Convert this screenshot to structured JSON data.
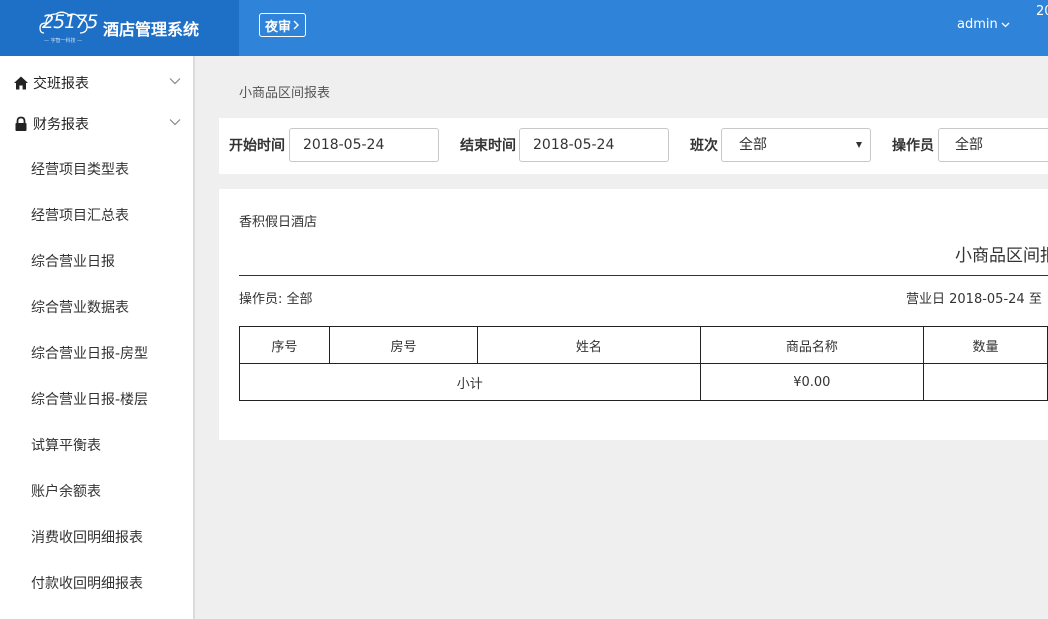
{
  "header": {
    "logo_number": "25175",
    "logo_tagline": "— 宇智一科技 —",
    "app_title": "酒店管理系统",
    "night_audit_label": "夜审",
    "user_name": "admin",
    "clock_fragment": "20"
  },
  "sidebar": {
    "groups": [
      {
        "label": "交班报表",
        "icon": "home-icon"
      },
      {
        "label": "财务报表",
        "icon": "lock-icon"
      }
    ],
    "items": [
      {
        "label": "经营项目类型表"
      },
      {
        "label": "经营项目汇总表"
      },
      {
        "label": "综合营业日报"
      },
      {
        "label": "综合营业数据表"
      },
      {
        "label": "综合营业日报-房型"
      },
      {
        "label": "综合营业日报-楼层"
      },
      {
        "label": "试算平衡表"
      },
      {
        "label": "账户余额表"
      },
      {
        "label": "消费收回明细报表"
      },
      {
        "label": "付款收回明细报表"
      }
    ]
  },
  "breadcrumb": "小商品区间报表",
  "filters": {
    "start_label": "开始时间",
    "start_value": "2018-05-24",
    "end_label": "结束时间",
    "end_value": "2018-05-24",
    "shift_label": "班次",
    "shift_value": "全部",
    "operator_label": "操作员",
    "operator_value": "全部"
  },
  "report": {
    "hotel_name": "香积假日酒店",
    "title": "小商品区间报表",
    "operator_line": "操作员: 全部",
    "date_line": "营业日 2018-05-24 至",
    "columns": [
      "序号",
      "房号",
      "姓名",
      "商品名称",
      "数量"
    ],
    "subtotal_label": "小计",
    "subtotal_amount": "¥0.00"
  },
  "colors": {
    "header_bg": "#2f83d8",
    "brand_bg": "#1e6fc6",
    "page_bg": "#efefef"
  }
}
